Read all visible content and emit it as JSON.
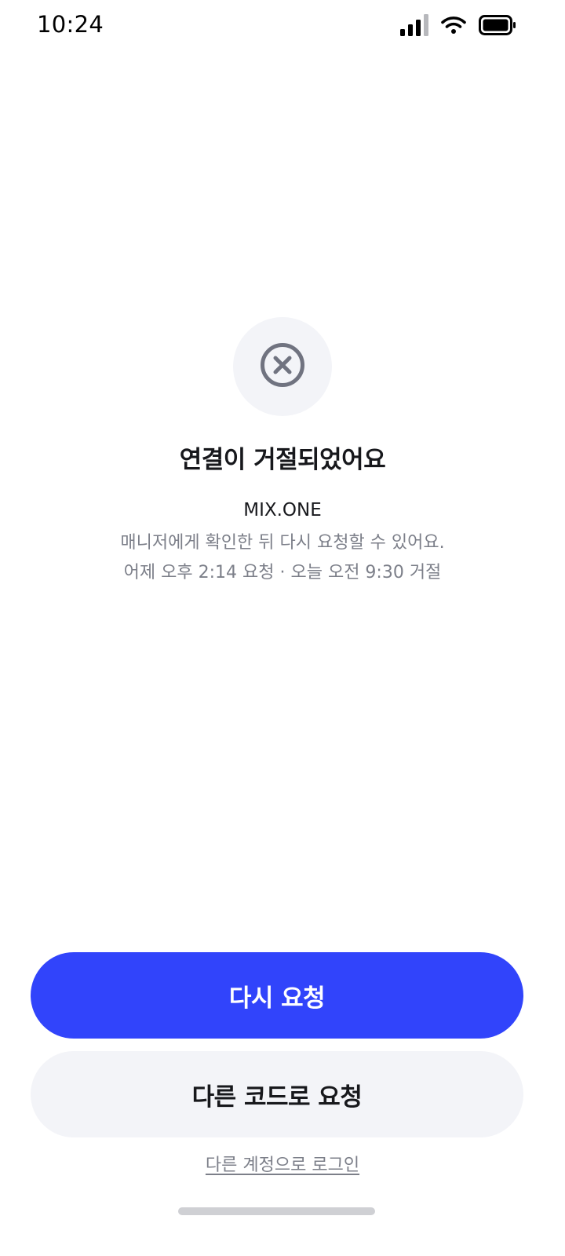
{
  "status_bar": {
    "time": "10:24",
    "icons": [
      "signal-icon",
      "wifi-icon",
      "battery-icon"
    ]
  },
  "result": {
    "icon": "x-circle-icon",
    "title": "연결이 거절되었어요",
    "company": "MIX.ONE",
    "description": "매니저에게 확인한 뒤 다시 요청할 수 있어요.",
    "timeline": "어제 오후 2:14 요청 · 오늘 오전 9:30 거절"
  },
  "actions": {
    "primary_label": "다시 요청",
    "secondary_label": "다른 코드로 요청",
    "link_label": "다른 계정으로 로그인"
  },
  "colors": {
    "accent": "#3144fb",
    "secondary_bg": "#f3f4f8",
    "muted_text": "#7c7f89"
  }
}
